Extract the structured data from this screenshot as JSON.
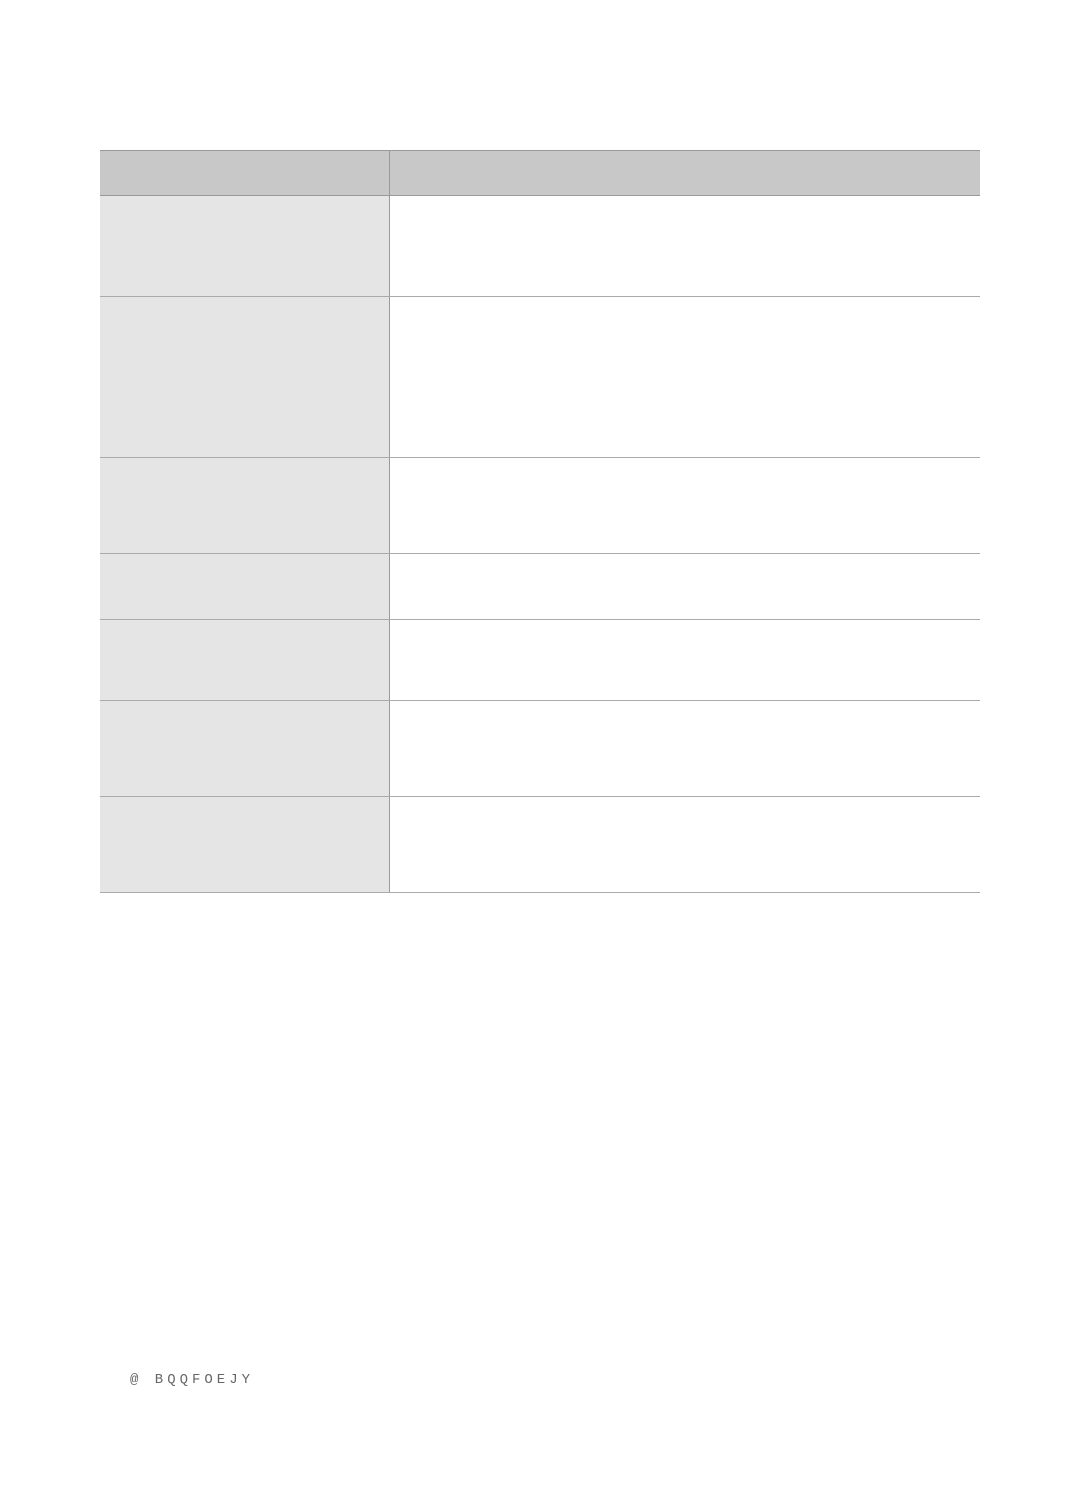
{
  "table": {
    "header": {
      "left": "",
      "right": ""
    },
    "rows": [
      {
        "left": "",
        "right": ""
      },
      {
        "left": "",
        "right": ""
      },
      {
        "left": "",
        "right": ""
      },
      {
        "left": "",
        "right": ""
      },
      {
        "left": "",
        "right": ""
      },
      {
        "left": "",
        "right": ""
      },
      {
        "left": "",
        "right": ""
      }
    ]
  },
  "footer": {
    "text": "@ BQQFOEJY"
  }
}
